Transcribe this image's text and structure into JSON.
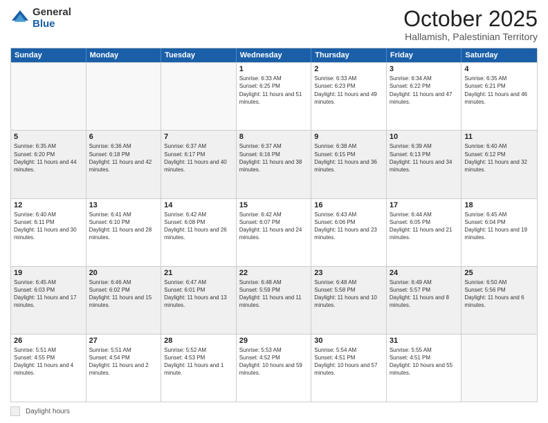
{
  "logo": {
    "general": "General",
    "blue": "Blue"
  },
  "title": "October 2025",
  "location": "Hallamish, Palestinian Territory",
  "days": [
    "Sunday",
    "Monday",
    "Tuesday",
    "Wednesday",
    "Thursday",
    "Friday",
    "Saturday"
  ],
  "footer": {
    "legend_label": "Daylight hours"
  },
  "weeks": [
    [
      {
        "day": "",
        "empty": true
      },
      {
        "day": "",
        "empty": true
      },
      {
        "day": "",
        "empty": true
      },
      {
        "day": "1",
        "sunrise": "Sunrise: 6:33 AM",
        "sunset": "Sunset: 6:25 PM",
        "daylight": "Daylight: 11 hours and 51 minutes."
      },
      {
        "day": "2",
        "sunrise": "Sunrise: 6:33 AM",
        "sunset": "Sunset: 6:23 PM",
        "daylight": "Daylight: 11 hours and 49 minutes."
      },
      {
        "day": "3",
        "sunrise": "Sunrise: 6:34 AM",
        "sunset": "Sunset: 6:22 PM",
        "daylight": "Daylight: 11 hours and 47 minutes."
      },
      {
        "day": "4",
        "sunrise": "Sunrise: 6:35 AM",
        "sunset": "Sunset: 6:21 PM",
        "daylight": "Daylight: 11 hours and 46 minutes."
      }
    ],
    [
      {
        "day": "5",
        "sunrise": "Sunrise: 6:35 AM",
        "sunset": "Sunset: 6:20 PM",
        "daylight": "Daylight: 11 hours and 44 minutes."
      },
      {
        "day": "6",
        "sunrise": "Sunrise: 6:36 AM",
        "sunset": "Sunset: 6:18 PM",
        "daylight": "Daylight: 11 hours and 42 minutes."
      },
      {
        "day": "7",
        "sunrise": "Sunrise: 6:37 AM",
        "sunset": "Sunset: 6:17 PM",
        "daylight": "Daylight: 11 hours and 40 minutes."
      },
      {
        "day": "8",
        "sunrise": "Sunrise: 6:37 AM",
        "sunset": "Sunset: 6:16 PM",
        "daylight": "Daylight: 11 hours and 38 minutes."
      },
      {
        "day": "9",
        "sunrise": "Sunrise: 6:38 AM",
        "sunset": "Sunset: 6:15 PM",
        "daylight": "Daylight: 11 hours and 36 minutes."
      },
      {
        "day": "10",
        "sunrise": "Sunrise: 6:39 AM",
        "sunset": "Sunset: 6:13 PM",
        "daylight": "Daylight: 11 hours and 34 minutes."
      },
      {
        "day": "11",
        "sunrise": "Sunrise: 6:40 AM",
        "sunset": "Sunset: 6:12 PM",
        "daylight": "Daylight: 11 hours and 32 minutes."
      }
    ],
    [
      {
        "day": "12",
        "sunrise": "Sunrise: 6:40 AM",
        "sunset": "Sunset: 6:11 PM",
        "daylight": "Daylight: 11 hours and 30 minutes."
      },
      {
        "day": "13",
        "sunrise": "Sunrise: 6:41 AM",
        "sunset": "Sunset: 6:10 PM",
        "daylight": "Daylight: 11 hours and 28 minutes."
      },
      {
        "day": "14",
        "sunrise": "Sunrise: 6:42 AM",
        "sunset": "Sunset: 6:08 PM",
        "daylight": "Daylight: 11 hours and 26 minutes."
      },
      {
        "day": "15",
        "sunrise": "Sunrise: 6:42 AM",
        "sunset": "Sunset: 6:07 PM",
        "daylight": "Daylight: 11 hours and 24 minutes."
      },
      {
        "day": "16",
        "sunrise": "Sunrise: 6:43 AM",
        "sunset": "Sunset: 6:06 PM",
        "daylight": "Daylight: 11 hours and 23 minutes."
      },
      {
        "day": "17",
        "sunrise": "Sunrise: 6:44 AM",
        "sunset": "Sunset: 6:05 PM",
        "daylight": "Daylight: 11 hours and 21 minutes."
      },
      {
        "day": "18",
        "sunrise": "Sunrise: 6:45 AM",
        "sunset": "Sunset: 6:04 PM",
        "daylight": "Daylight: 11 hours and 19 minutes."
      }
    ],
    [
      {
        "day": "19",
        "sunrise": "Sunrise: 6:45 AM",
        "sunset": "Sunset: 6:03 PM",
        "daylight": "Daylight: 11 hours and 17 minutes."
      },
      {
        "day": "20",
        "sunrise": "Sunrise: 6:46 AM",
        "sunset": "Sunset: 6:02 PM",
        "daylight": "Daylight: 11 hours and 15 minutes."
      },
      {
        "day": "21",
        "sunrise": "Sunrise: 6:47 AM",
        "sunset": "Sunset: 6:01 PM",
        "daylight": "Daylight: 11 hours and 13 minutes."
      },
      {
        "day": "22",
        "sunrise": "Sunrise: 6:48 AM",
        "sunset": "Sunset: 5:59 PM",
        "daylight": "Daylight: 11 hours and 11 minutes."
      },
      {
        "day": "23",
        "sunrise": "Sunrise: 6:48 AM",
        "sunset": "Sunset: 5:58 PM",
        "daylight": "Daylight: 11 hours and 10 minutes."
      },
      {
        "day": "24",
        "sunrise": "Sunrise: 6:49 AM",
        "sunset": "Sunset: 5:57 PM",
        "daylight": "Daylight: 11 hours and 8 minutes."
      },
      {
        "day": "25",
        "sunrise": "Sunrise: 6:50 AM",
        "sunset": "Sunset: 5:56 PM",
        "daylight": "Daylight: 11 hours and 6 minutes."
      }
    ],
    [
      {
        "day": "26",
        "sunrise": "Sunrise: 5:51 AM",
        "sunset": "Sunset: 4:55 PM",
        "daylight": "Daylight: 11 hours and 4 minutes."
      },
      {
        "day": "27",
        "sunrise": "Sunrise: 5:51 AM",
        "sunset": "Sunset: 4:54 PM",
        "daylight": "Daylight: 11 hours and 2 minutes."
      },
      {
        "day": "28",
        "sunrise": "Sunrise: 5:52 AM",
        "sunset": "Sunset: 4:53 PM",
        "daylight": "Daylight: 11 hours and 1 minute."
      },
      {
        "day": "29",
        "sunrise": "Sunrise: 5:53 AM",
        "sunset": "Sunset: 4:52 PM",
        "daylight": "Daylight: 10 hours and 59 minutes."
      },
      {
        "day": "30",
        "sunrise": "Sunrise: 5:54 AM",
        "sunset": "Sunset: 4:51 PM",
        "daylight": "Daylight: 10 hours and 57 minutes."
      },
      {
        "day": "31",
        "sunrise": "Sunrise: 5:55 AM",
        "sunset": "Sunset: 4:51 PM",
        "daylight": "Daylight: 10 hours and 55 minutes."
      },
      {
        "day": "",
        "empty": true
      }
    ]
  ]
}
